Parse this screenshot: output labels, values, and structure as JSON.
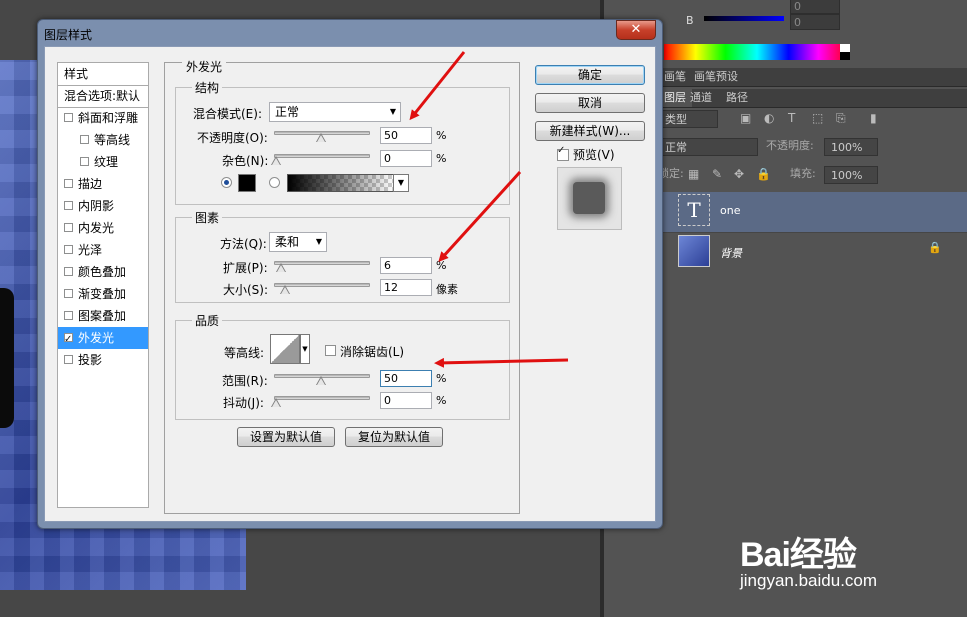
{
  "background": {
    "color_panel": {
      "b_label": "B",
      "field_top": "0",
      "field_b": "0"
    },
    "tabs_top": [
      "画笔",
      "画笔预设"
    ],
    "tabs_layers": [
      "图层",
      "通道",
      "路径"
    ],
    "layer_filter": "类型",
    "blend_mode": "正常",
    "opacity_label": "不透明度:",
    "opacity_value": "100%",
    "lock_label": "锁定:",
    "fill_label": "填充:",
    "fill_value": "100%",
    "layers": [
      {
        "name": "one",
        "thumb_glyph": "T"
      },
      {
        "name": "背景"
      }
    ],
    "watermark": {
      "brand": "Bai经验",
      "url": "jingyan.baidu.com"
    }
  },
  "dialog": {
    "title": "图层样式",
    "close_label": "✕",
    "styles_list": [
      {
        "label": "样式",
        "type": "header"
      },
      {
        "label": "混合选项:默认",
        "type": "header"
      },
      {
        "label": "斜面和浮雕",
        "checked": false,
        "indent": 0
      },
      {
        "label": "等高线",
        "checked": false,
        "indent": 1
      },
      {
        "label": "纹理",
        "checked": false,
        "indent": 1
      },
      {
        "label": "描边",
        "checked": false,
        "indent": 0
      },
      {
        "label": "内阴影",
        "checked": false,
        "indent": 0
      },
      {
        "label": "内发光",
        "checked": false,
        "indent": 0
      },
      {
        "label": "光泽",
        "checked": false,
        "indent": 0
      },
      {
        "label": "颜色叠加",
        "checked": false,
        "indent": 0
      },
      {
        "label": "渐变叠加",
        "checked": false,
        "indent": 0
      },
      {
        "label": "图案叠加",
        "checked": false,
        "indent": 0
      },
      {
        "label": "外发光",
        "checked": true,
        "indent": 0,
        "selected": true
      },
      {
        "label": "投影",
        "checked": false,
        "indent": 0
      }
    ],
    "panel_title": "外发光",
    "structure": {
      "title": "结构",
      "blend_mode_label": "混合模式(E):",
      "blend_mode_value": "正常",
      "opacity_label": "不透明度(O):",
      "opacity_value": "50",
      "opacity_unit": "%",
      "opacity_level": 0.5,
      "noise_label": "杂色(N):",
      "noise_value": "0",
      "noise_unit": "%",
      "noise_level": 0,
      "glow_color": "#000000"
    },
    "elements": {
      "title": "图素",
      "technique_label": "方法(Q):",
      "technique_value": "柔和",
      "spread_label": "扩展(P):",
      "spread_value": "6",
      "spread_unit": "%",
      "spread_level": 0.06,
      "size_label": "大小(S):",
      "size_value": "12",
      "size_unit": "像素",
      "size_level": 0.1
    },
    "quality": {
      "title": "品质",
      "contour_label": "等高线:",
      "antialias_label": "消除锯齿(L)",
      "antialias_checked": false,
      "range_label": "范围(R):",
      "range_value": "50",
      "range_unit": "%",
      "range_level": 0.5,
      "jitter_label": "抖动(J):",
      "jitter_value": "0",
      "jitter_unit": "%",
      "jitter_level": 0
    },
    "buttons": {
      "make_default": "设置为默认值",
      "reset_default": "复位为默认值",
      "ok": "确定",
      "cancel": "取消",
      "new_style": "新建样式(W)...",
      "preview_label": "预览(V)",
      "preview_checked": true
    }
  },
  "colors": {
    "selection": "#3399ff",
    "dialog_frame": "#7b8fae",
    "annotation_arrow": "#e01010",
    "selected_layer": "#5b6a86"
  }
}
